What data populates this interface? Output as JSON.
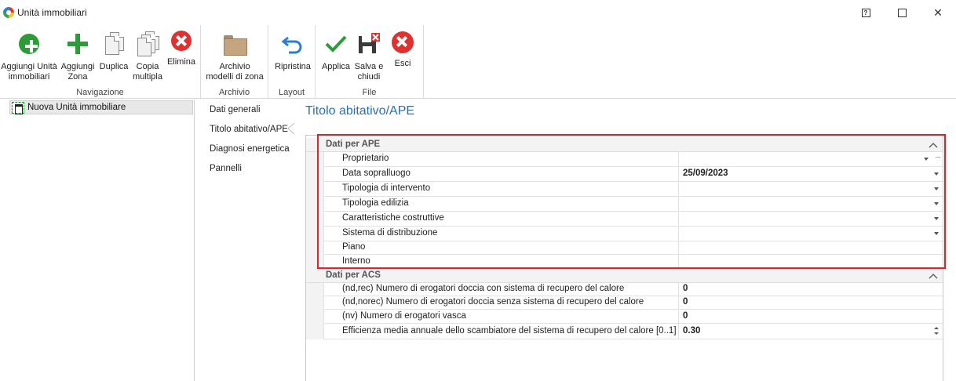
{
  "window": {
    "title": "Unità immobiliari",
    "help_glyph": "?",
    "close_glyph": "✕"
  },
  "ribbon": {
    "groups": {
      "navigazione": "Navigazione",
      "archivio": "Archivio",
      "layout": "Layout",
      "file": "File"
    },
    "buttons": {
      "aggiungi_unita": "Aggiungi Unità\nimmobiliari",
      "aggiungi_zona": "Aggiungi\nZona",
      "duplica": "Duplica",
      "copia_multipla": "Copia\nmultipla",
      "elimina": "Elimina",
      "archivio_modelli": "Archivio\nmodelli di zona",
      "ripristina": "Ripristina",
      "applica": "Applica",
      "salva_chiudi": "Salva e\nchiudi",
      "esci": "Esci"
    },
    "colors": {
      "green": "#2e9a3a",
      "red": "#e03131",
      "blue": "#2a6fb5"
    }
  },
  "tree": {
    "items": [
      {
        "label": "Nuova Unità immobiliare",
        "icon": "building-plan-icon"
      }
    ]
  },
  "nav": {
    "items": [
      "Dati generali",
      "Titolo abitativo/APE",
      "Diagnosi energetica",
      "Pannelli"
    ],
    "selected": "Titolo abitativo/APE"
  },
  "main": {
    "title": "Titolo abitativo/APE",
    "categories": [
      {
        "label": "Dati per APE",
        "rows": [
          {
            "name": "Proprietario",
            "value": "",
            "editor": "dropdown-ellipsis"
          },
          {
            "name": "Data sopralluogo",
            "value": "25/09/2023",
            "editor": "dropdown"
          },
          {
            "name": "Tipologia di intervento",
            "value": "",
            "editor": "dropdown"
          },
          {
            "name": "Tipologia edilizia",
            "value": "",
            "editor": "dropdown"
          },
          {
            "name": "Caratteristiche costruttive",
            "value": "",
            "editor": "dropdown"
          },
          {
            "name": "Sistema di distribuzione",
            "value": "",
            "editor": "dropdown"
          },
          {
            "name": "Piano",
            "value": "",
            "editor": "text"
          },
          {
            "name": "Interno",
            "value": "",
            "editor": "text"
          }
        ]
      },
      {
        "label": "Dati per ACS",
        "rows": [
          {
            "name": "(nd,rec) Numero di erogatori doccia con sistema di recupero del calore",
            "value": "0",
            "editor": "text"
          },
          {
            "name": "(nd,norec) Numero di erogatori doccia senza sistema di recupero del calore",
            "value": "0",
            "editor": "text"
          },
          {
            "name": "(nv) Numero di erogatori vasca",
            "value": "0",
            "editor": "text"
          },
          {
            "name": "Efficienza media annuale dello scambiatore del sistema di recupero del calore [0..1]",
            "value": "0.30",
            "editor": "spin"
          }
        ]
      }
    ]
  }
}
